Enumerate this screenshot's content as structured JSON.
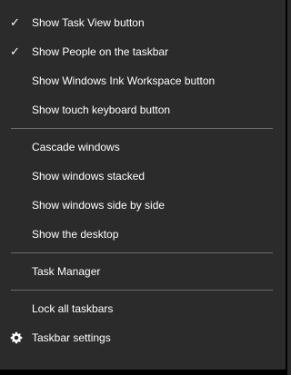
{
  "menu": {
    "items": [
      {
        "label": "Show Task View button",
        "checked": true,
        "icon": "checkmark-icon"
      },
      {
        "label": "Show People on the taskbar",
        "checked": true,
        "icon": "checkmark-icon"
      },
      {
        "label": "Show Windows Ink Workspace button",
        "checked": false
      },
      {
        "label": "Show touch keyboard button",
        "checked": false
      },
      {
        "label": "Cascade windows"
      },
      {
        "label": "Show windows stacked"
      },
      {
        "label": "Show windows side by side"
      },
      {
        "label": "Show the desktop"
      },
      {
        "label": "Task Manager"
      },
      {
        "label": "Lock all taskbars"
      },
      {
        "label": "Taskbar settings",
        "icon": "gear-icon"
      }
    ],
    "check_glyph": "✓"
  },
  "colors": {
    "background": "#2b2b2b",
    "text": "#ffffff",
    "separator": "#6b6b6b"
  }
}
